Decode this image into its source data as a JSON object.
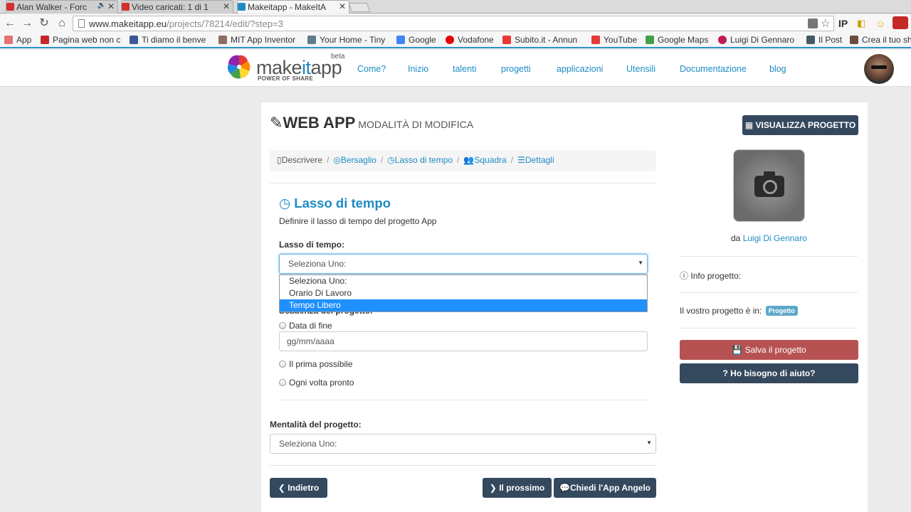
{
  "browser": {
    "tabs": [
      {
        "title": "Alan Walker - Forc",
        "favicon_color": "#d32f2f"
      },
      {
        "title": "Video caricati: 1 di 1",
        "favicon_color": "#d32f2f"
      },
      {
        "title": "Makeitapp - MakeItA",
        "favicon_color": "#1d8bc4"
      }
    ],
    "url_host": "www.makeitapp.eu",
    "url_path": "/projects/78214/edit/?step=3",
    "ext_ip": "IP",
    "bookmarks": [
      {
        "label": "App",
        "color": "#e57373"
      },
      {
        "label": "Pagina web non c",
        "color": "#c62828"
      },
      {
        "label": "Ti diamo il benve",
        "color": "#3b5998"
      },
      {
        "label": "MIT App Inventor",
        "color": "#8d6e63"
      },
      {
        "label": "Your Home - Tiny",
        "color": "#607d8b"
      },
      {
        "label": "Google",
        "color": "#4285f4"
      },
      {
        "label": "Vodafone",
        "color": "#e60000"
      },
      {
        "label": "Subito.it - Annun",
        "color": "#e53935"
      },
      {
        "label": "YouTube",
        "color": "#e53935"
      },
      {
        "label": "Google Maps",
        "color": "#43a047"
      },
      {
        "label": "Luigi Di Gennaro",
        "color": "#c2185b"
      },
      {
        "label": "Il Post",
        "color": "#455a64"
      },
      {
        "label": "Crea il tuo sh",
        "color": "#6d4c41"
      }
    ]
  },
  "site": {
    "logo_part1": "make",
    "logo_part2": "it",
    "logo_part3": "app",
    "beta": "beta",
    "tagline": "POWER OF SHARE",
    "nav": [
      "Come?",
      "Inizio",
      "talenti",
      "progetti",
      "applicazioni",
      "Utensili",
      "Documentazione",
      "blog"
    ]
  },
  "page": {
    "title": "WEB APP",
    "subtitle": "MODALITÀ DI MODIFICA",
    "view_project_button": "VISUALIZZA PROGETTO",
    "breadcrumb": [
      "Descrivere",
      "Bersaglio",
      "Lasso di tempo",
      "Squadra",
      "Dettagli"
    ],
    "section_title": "Lasso di tempo",
    "section_desc": "Definire il lasso di tempo del progetto App",
    "timeframe_label": "Lasso di tempo:",
    "timeframe_value": "Seleziona Uno:",
    "timeframe_options": [
      "Seleziona Uno:",
      "Orario Di Lavoro",
      "Tempo Libero"
    ],
    "timeframe_highlighted": "Tempo Libero",
    "deadline_label": "Scadenza del progetto:",
    "radio_end_date": "Data di fine",
    "date_placeholder": "gg/mm/aaaa",
    "radio_asap": "Il prima possibile",
    "radio_whenever": "Ogni volta pronto",
    "mindset_label": "Mentalità del progetto:",
    "mindset_value": "Seleziona Uno:",
    "back_button": "Indietro",
    "next_button": "Il prossimo",
    "angel_button": "Chiedi l'App Angelo"
  },
  "sidebar": {
    "by_prefix": "da",
    "author": "Luigi Di Gennaro",
    "info_label": "Info progetto:",
    "status_text": "Il vostro progetto è in:",
    "status_badge": "Progetto",
    "save_button": "Salva il progetto",
    "help_button": "Ho bisogno di aiuto?"
  }
}
